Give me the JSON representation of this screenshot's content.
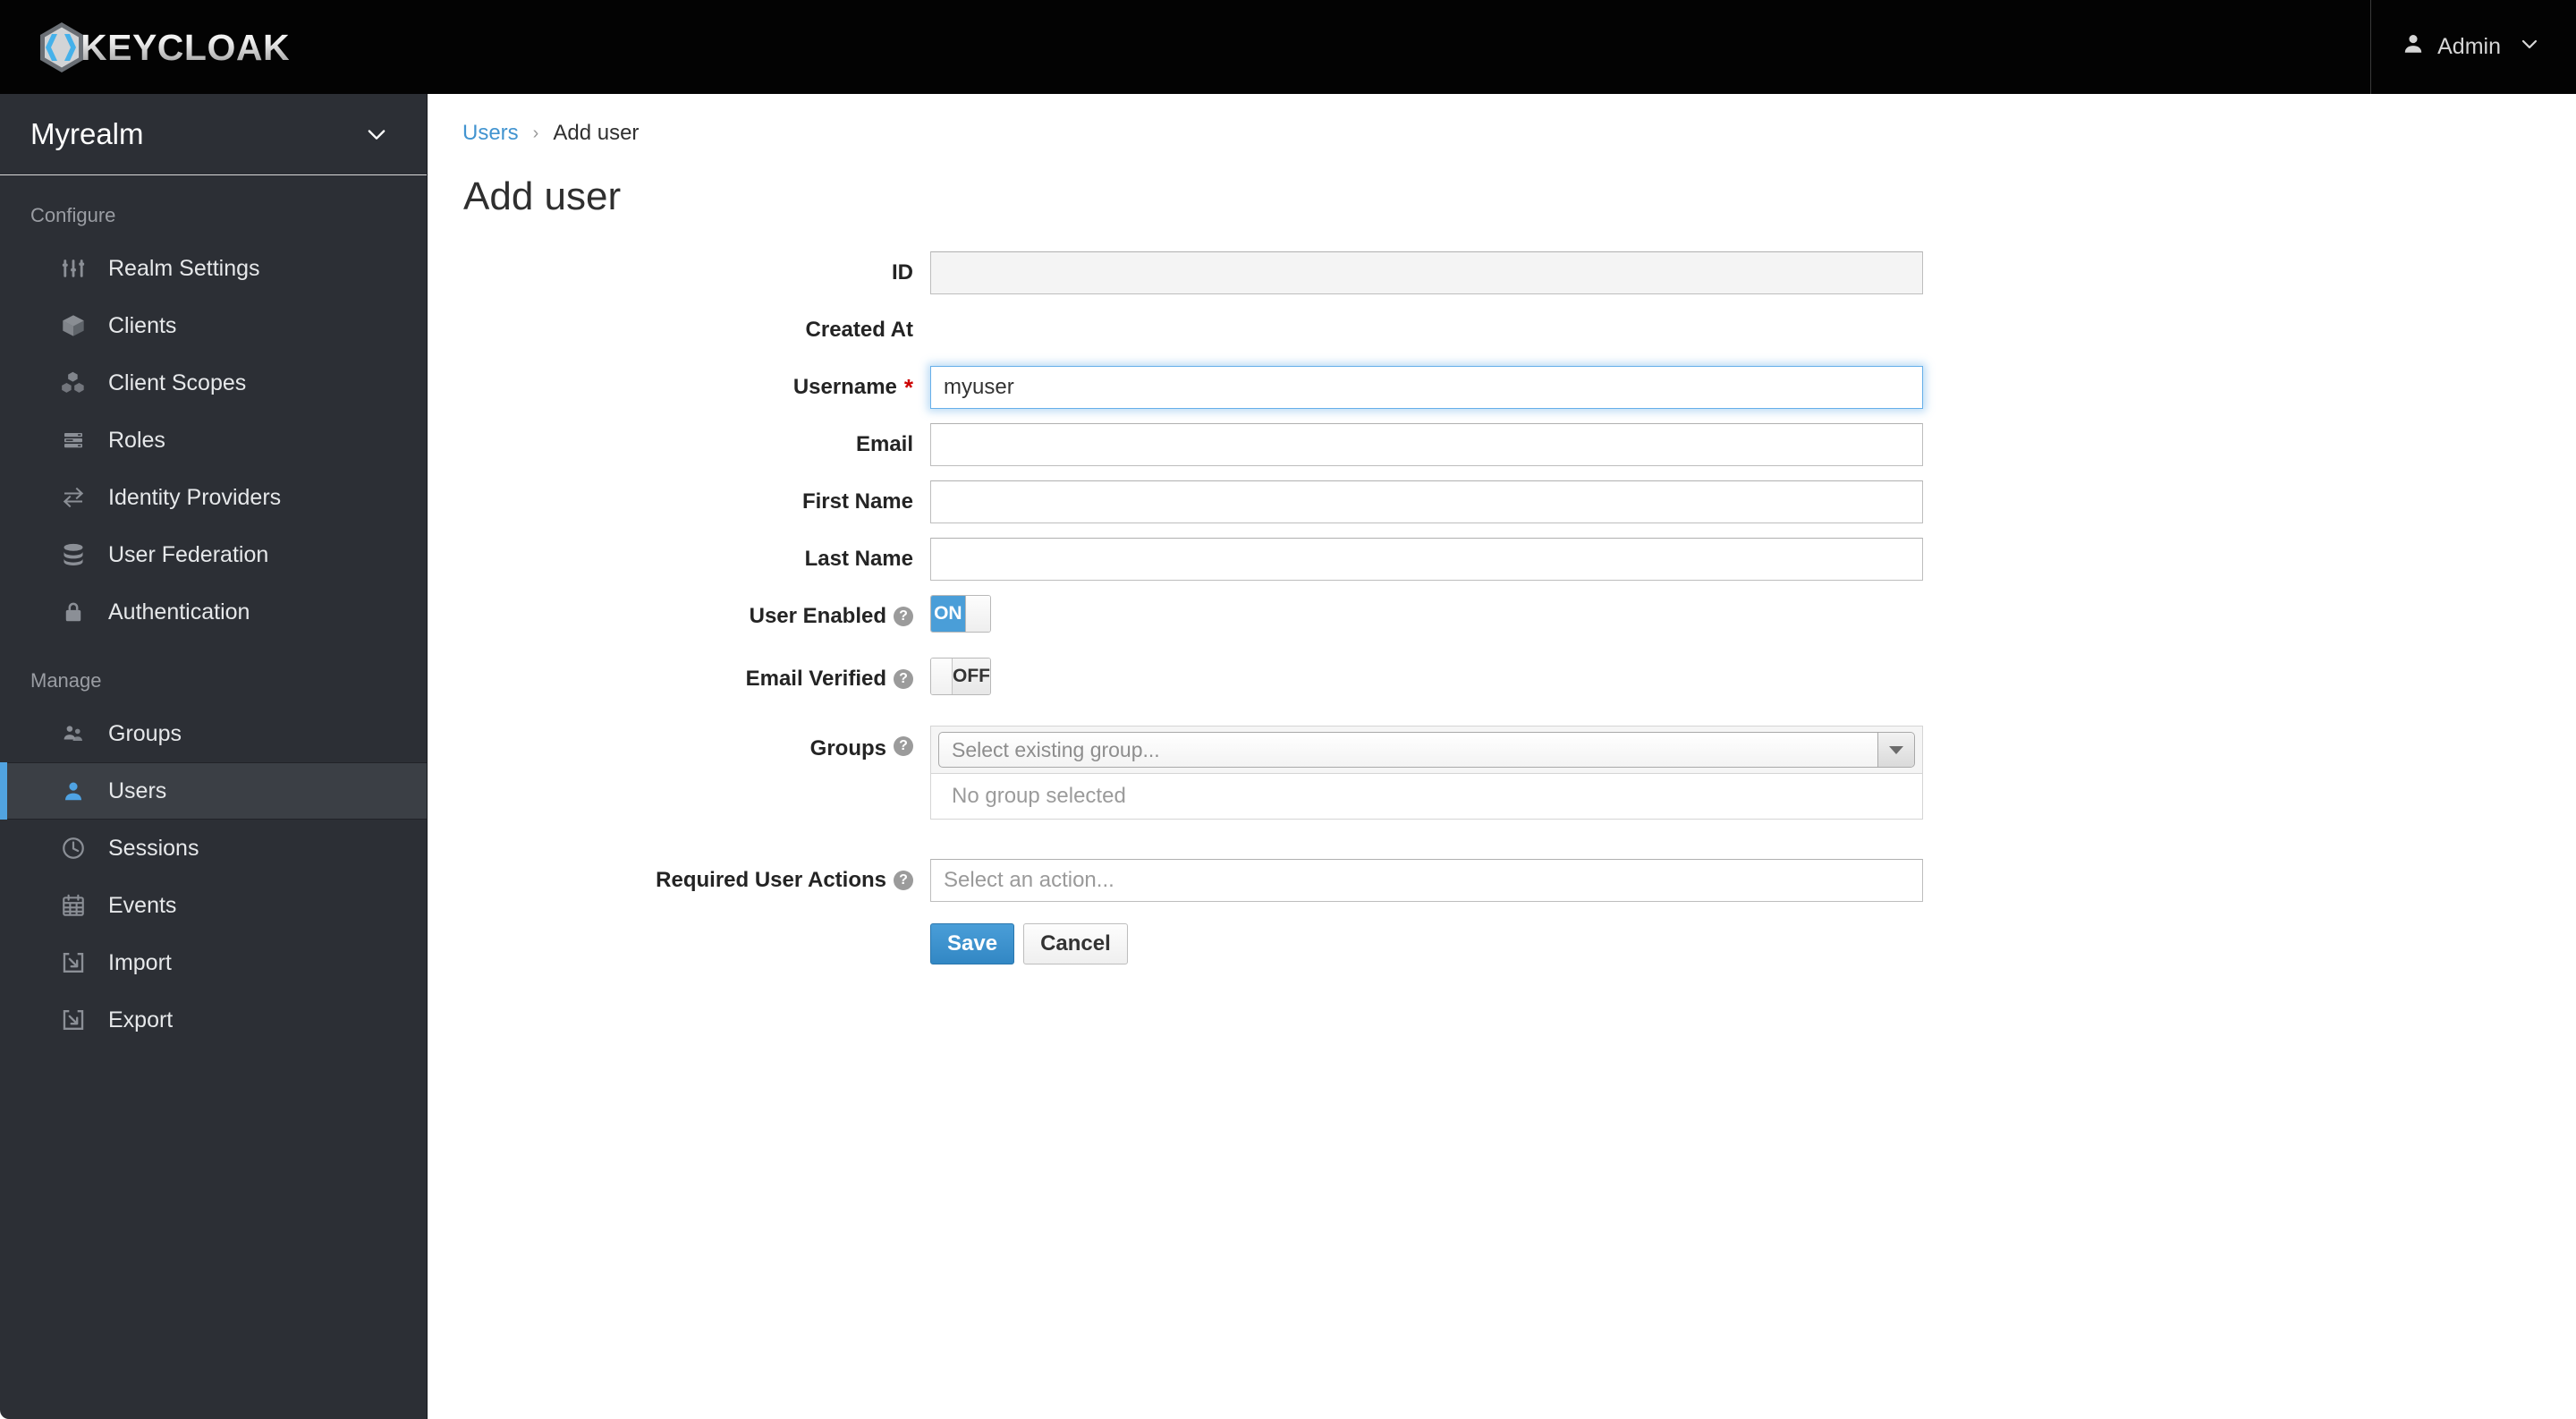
{
  "header": {
    "brand_name": "KEYCLOAK",
    "logo_icon": "keycloak-hexagon-logo",
    "user_label": "Admin",
    "user_icon": "user-icon",
    "caret_icon": "chevron-down-icon"
  },
  "sidebar": {
    "realm_name": "Myrealm",
    "realm_caret_icon": "chevron-down-icon",
    "sections": [
      {
        "label": "Configure",
        "items": [
          {
            "label": "Realm Settings",
            "icon": "sliders-icon",
            "active": false
          },
          {
            "label": "Clients",
            "icon": "cube-icon",
            "active": false
          },
          {
            "label": "Client Scopes",
            "icon": "cubes-icon",
            "active": false
          },
          {
            "label": "Roles",
            "icon": "list-rows-icon",
            "active": false
          },
          {
            "label": "Identity Providers",
            "icon": "exchange-arrows-icon",
            "active": false
          },
          {
            "label": "User Federation",
            "icon": "database-icon",
            "active": false
          },
          {
            "label": "Authentication",
            "icon": "lock-icon",
            "active": false
          }
        ]
      },
      {
        "label": "Manage",
        "items": [
          {
            "label": "Groups",
            "icon": "users-group-icon",
            "active": false
          },
          {
            "label": "Users",
            "icon": "user-icon",
            "active": true
          },
          {
            "label": "Sessions",
            "icon": "clock-icon",
            "active": false
          },
          {
            "label": "Events",
            "icon": "calendar-icon",
            "active": false
          },
          {
            "label": "Import",
            "icon": "import-arrow-icon",
            "active": false
          },
          {
            "label": "Export",
            "icon": "export-arrow-icon",
            "active": false
          }
        ]
      }
    ]
  },
  "breadcrumb": {
    "parent": "Users",
    "separator": "›",
    "current": "Add user"
  },
  "page": {
    "title": "Add user"
  },
  "form": {
    "id": {
      "label": "ID",
      "value": "",
      "placeholder": "",
      "disabled": true
    },
    "created_at": {
      "label": "Created At"
    },
    "username": {
      "label": "Username",
      "required_mark": "*",
      "value": "myuser",
      "placeholder": "",
      "focused": true
    },
    "email": {
      "label": "Email",
      "value": "",
      "placeholder": ""
    },
    "first_name": {
      "label": "First Name",
      "value": "",
      "placeholder": ""
    },
    "last_name": {
      "label": "Last Name",
      "value": "",
      "placeholder": ""
    },
    "user_enabled": {
      "label": "User Enabled",
      "help_icon": "help-circle-icon",
      "state": "ON",
      "on_label": "ON"
    },
    "email_verified": {
      "label": "Email Verified",
      "help_icon": "help-circle-icon",
      "state": "OFF",
      "off_label": "OFF"
    },
    "groups": {
      "label": "Groups",
      "help_icon": "help-circle-icon",
      "select_placeholder": "Select existing group...",
      "caret_icon": "caret-down-icon",
      "empty_text": "No group selected"
    },
    "required_user_actions": {
      "label": "Required User Actions",
      "help_icon": "help-circle-icon",
      "placeholder": "Select an action...",
      "value": ""
    },
    "buttons": {
      "save": "Save",
      "cancel": "Cancel"
    }
  },
  "colors": {
    "accent_blue": "#4a9ed8",
    "link_blue": "#4294d0",
    "sidebar_bg": "#2c2f35",
    "sidebar_active_bg": "#3b3f45",
    "header_bg": "#030303",
    "required_red": "#cc0000"
  }
}
